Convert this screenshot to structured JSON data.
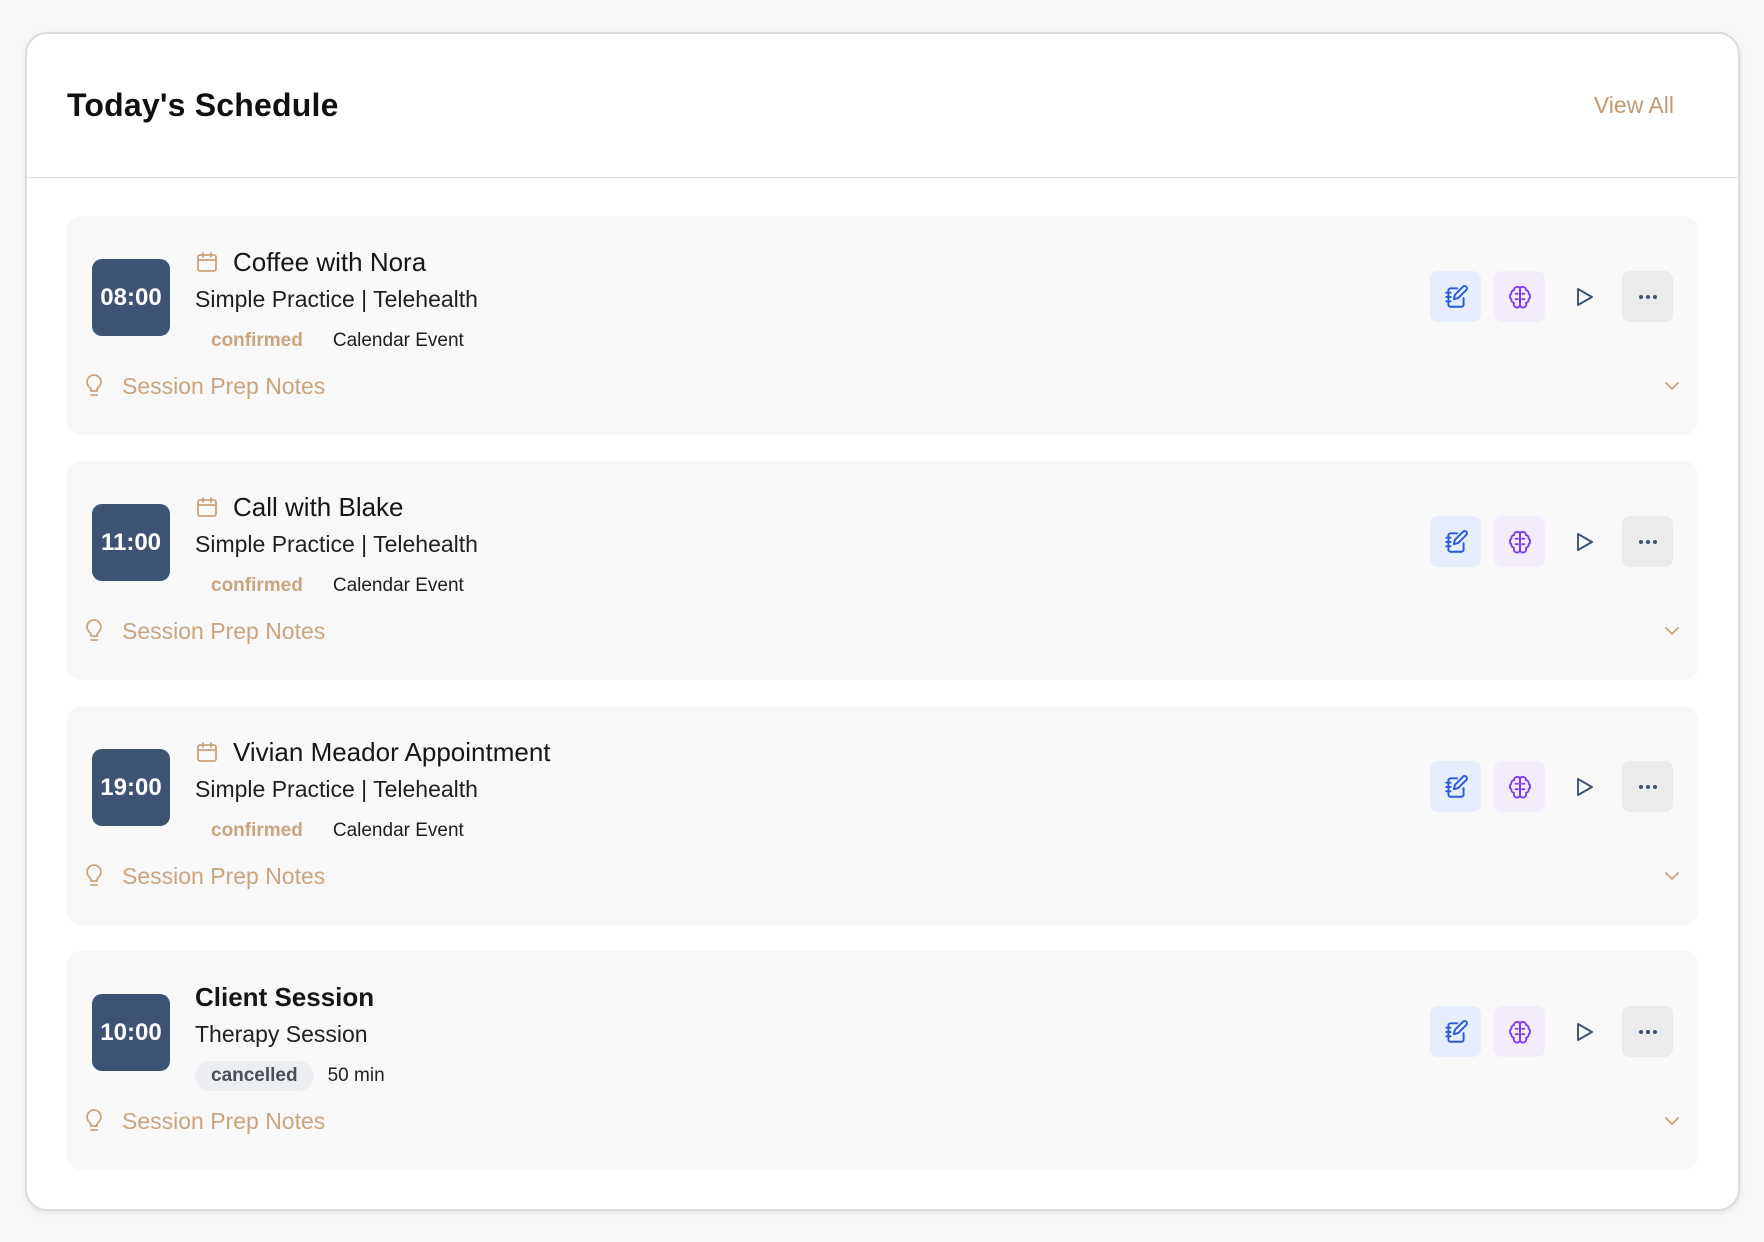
{
  "header": {
    "title": "Today's Schedule",
    "view_all_label": "View All"
  },
  "appointments": [
    {
      "time": "08:00",
      "title": "Coffee with Nora",
      "subtitle": "Simple Practice | Telehealth",
      "status": "confirmed",
      "meta": "Calendar Event",
      "has_calendar_icon": true,
      "prep_label": "Session Prep Notes"
    },
    {
      "time": "11:00",
      "title": "Call with Blake",
      "subtitle": "Simple Practice | Telehealth",
      "status": "confirmed",
      "meta": "Calendar Event",
      "has_calendar_icon": true,
      "prep_label": "Session Prep Notes"
    },
    {
      "time": "19:00",
      "title": "Vivian Meador Appointment",
      "subtitle": "Simple Practice | Telehealth",
      "status": "confirmed",
      "meta": "Calendar Event",
      "has_calendar_icon": true,
      "prep_label": "Session Prep Notes"
    },
    {
      "time": "10:00",
      "title": "Client Session",
      "subtitle": "Therapy Session",
      "status": "cancelled",
      "meta": "50 min",
      "has_calendar_icon": false,
      "prep_label": "Session Prep Notes"
    }
  ],
  "icons": {
    "calendar": "calendar-icon",
    "notes": "notes-edit-icon",
    "brain": "brain-icon",
    "play": "play-icon",
    "more": "more-horizontal-icon",
    "bulb": "lightbulb-icon",
    "chevron": "chevron-down-icon"
  },
  "colors": {
    "accent": "#c29a70",
    "time_badge": "#3d5373",
    "notes_icon": "#2a5bd7",
    "brain_icon": "#7c3aed",
    "play_icon": "#3d5373"
  }
}
